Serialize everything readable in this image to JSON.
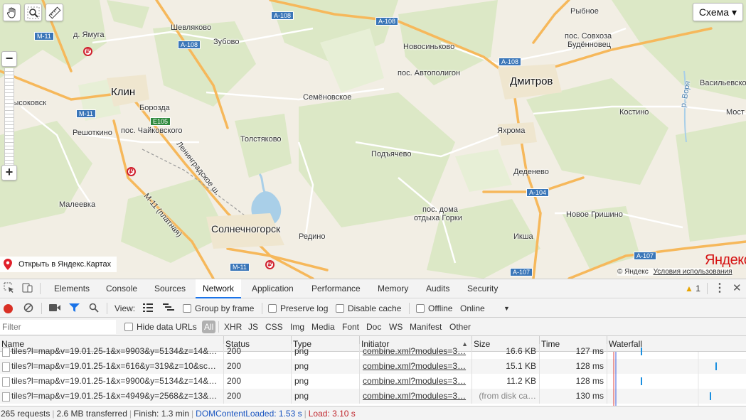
{
  "map": {
    "places": {
      "klin": "Клин",
      "dmitrov": "Дмитров",
      "solnechnogorsk": "Солнечногорск",
      "shevlyakovo": "Шевляково",
      "zubovo": "Зубово",
      "yamuga": "д. Ямуга",
      "novosinkovo": "Новосиньково",
      "rybnoe": "Рыбное",
      "sovkhoz": "пос. Совхоза",
      "budennovets": "Будённовец",
      "avtopoligon": "пос. Автополигон",
      "vasilevskoe": "Васильевско",
      "vysokovsk": "Высоковск",
      "borozda": "Борозда",
      "chaikovsky": "пос. Чайковского",
      "semenovskoe": "Семёновское",
      "kostino": "Костино",
      "most": "Мост",
      "reshotkino": "Решоткино",
      "tolstyakovo": "Толстяково",
      "yakhroma": "Яхрома",
      "podyachevo": "Подъячево",
      "dedenevo": "Деденево",
      "maleevka": "Малеевка",
      "gorki1": "пос. дома",
      "gorki2": "отдыха Горки",
      "novoe_grishino": "Новое Гришино",
      "redino": "Редино",
      "iksha": "Икша",
      "volgusha": "р. Воря",
      "leningradskoe": "Ленинградское ш.",
      "m11_toll": "М-11 (платная)"
    },
    "roads": {
      "a108": "А-108",
      "m11": "М-11",
      "e105": "E105",
      "a104": "А-104",
      "a107": "А-107"
    },
    "toll_icon": "₽",
    "schema_button": "Схема ▾",
    "open_in_yandex": "Открыть в Яндекс.Картах",
    "logo": "Яндекс",
    "copyright": "© Яндекс",
    "terms": "Условия использования",
    "zoom_in": "+",
    "zoom_out": "−",
    "colors": {
      "water": "#a9cfe8",
      "forest": "#dde9c8",
      "road_major": "#f6b85b",
      "road_minor": "#ffffff",
      "shield": "#3a76b8"
    }
  },
  "devtools": {
    "tabs": [
      "Elements",
      "Console",
      "Sources",
      "Network",
      "Application",
      "Performance",
      "Memory",
      "Audits",
      "Security"
    ],
    "active_tab": "Network",
    "warnings_count": "1",
    "toolbar": {
      "view_label": "View:",
      "group_by_frame": "Group by frame",
      "preserve_log": "Preserve log",
      "disable_cache": "Disable cache",
      "offline": "Offline",
      "throttling": "Online"
    },
    "filterbar": {
      "filter_placeholder": "Filter",
      "hide_data_urls": "Hide data URLs",
      "types": [
        "All",
        "XHR",
        "JS",
        "CSS",
        "Img",
        "Media",
        "Font",
        "Doc",
        "WS",
        "Manifest",
        "Other"
      ]
    },
    "columns": [
      "Name",
      "Status",
      "Type",
      "Initiator",
      "Size",
      "Time",
      "Waterfall"
    ],
    "rows": [
      {
        "name": "tiles?l=map&v=19.01.25-1&x=9903&y=5134&z=14&…",
        "status": "200",
        "type": "png",
        "initiator": "combine.xml?modules=3…",
        "size": "16.6 KB",
        "time": "127 ms",
        "wf": 0.24
      },
      {
        "name": "tiles?l=map&v=19.01.25-1&x=616&y=319&z=10&sc…",
        "status": "200",
        "type": "png",
        "initiator": "combine.xml?modules=3…",
        "size": "15.1 KB",
        "time": "128 ms",
        "wf": 0.78
      },
      {
        "name": "tiles?l=map&v=19.01.25-1&x=9900&y=5134&z=14&…",
        "status": "200",
        "type": "png",
        "initiator": "combine.xml?modules=3…",
        "size": "11.2 KB",
        "time": "128 ms",
        "wf": 0.24
      },
      {
        "name": "tiles?l=map&v=19.01.25-1&x=4949&y=2568&z=13&…",
        "status": "200",
        "type": "png",
        "initiator": "combine.xml?modules=3…",
        "size": "(from disk ca…",
        "time": "130 ms",
        "wf": 0.74
      }
    ],
    "status": {
      "requests": "265 requests",
      "transferred": "2.6 MB transferred",
      "finish": "Finish: 1.3 min",
      "dcl": "DOMContentLoaded: 1.53 s",
      "load": "Load: 3.10 s"
    }
  }
}
